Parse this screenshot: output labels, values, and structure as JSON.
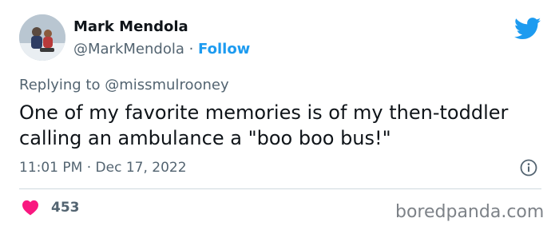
{
  "author": {
    "name": "Mark Mendola",
    "handle": "@MarkMendola",
    "separator": " · ",
    "follow_label": "Follow",
    "avatar_icon": "avatar-photo"
  },
  "reply": {
    "prefix": "Replying to ",
    "mention": "@missmulrooney"
  },
  "tweet": {
    "text": "One of my favorite memories is of my then-toddler calling an ambulance a \"boo boo bus!\"",
    "timestamp": "11:01 PM · Dec 17, 2022"
  },
  "stats": {
    "likes": "453"
  },
  "watermark": "boredpanda.com",
  "colors": {
    "twitter_blue": "#1d9bf0",
    "heart_pink": "#f91880",
    "muted_text": "#536471"
  },
  "icons": [
    "twitter-bird-icon",
    "info-icon",
    "heart-icon"
  ]
}
